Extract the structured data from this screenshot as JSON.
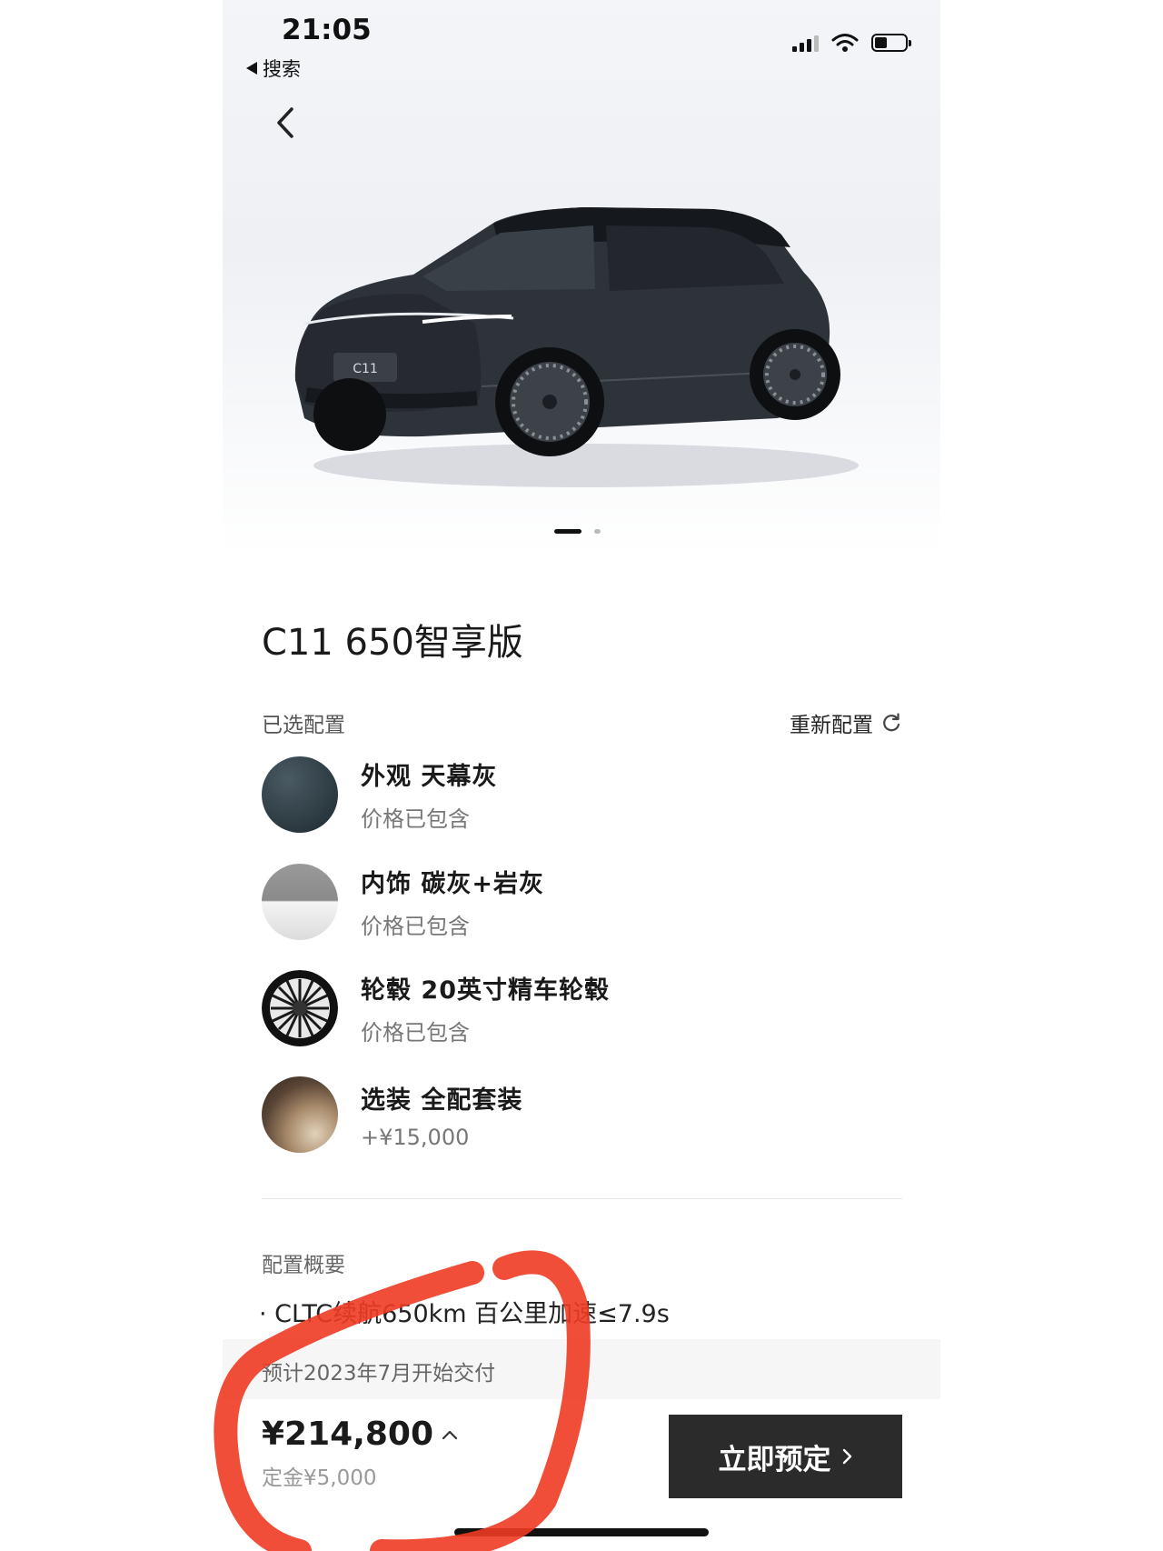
{
  "status_bar": {
    "time": "21:05",
    "back_app": "搜索"
  },
  "car_badge": "C11",
  "model_title": "C11 650智享版",
  "selected_config": {
    "label": "已选配置",
    "reconfigure": "重新配置",
    "items": [
      {
        "category": "外观",
        "name": "天幕灰",
        "price": "价格已包含"
      },
      {
        "category": "内饰",
        "name": "碳灰+岩灰",
        "price": "价格已包含"
      },
      {
        "category": "轮毂",
        "name": "20英寸精车轮毂",
        "price": "价格已包含"
      },
      {
        "category": "选装",
        "name": "全配套装",
        "price": "+¥15,000"
      }
    ]
  },
  "summary": {
    "label": "配置概要",
    "items": [
      "CLTC续航650km 百公里加速≤7.9s"
    ]
  },
  "delivery": "预计2023年7月开始交付",
  "price": {
    "total": "¥214,800",
    "deposit": "定金¥5,000"
  },
  "reserve_button": "立即预定",
  "colors": {
    "exterior_swatch": "#2f3d44",
    "button_bg": "#2b2b2b",
    "annotation_red": "#ee3b22"
  }
}
